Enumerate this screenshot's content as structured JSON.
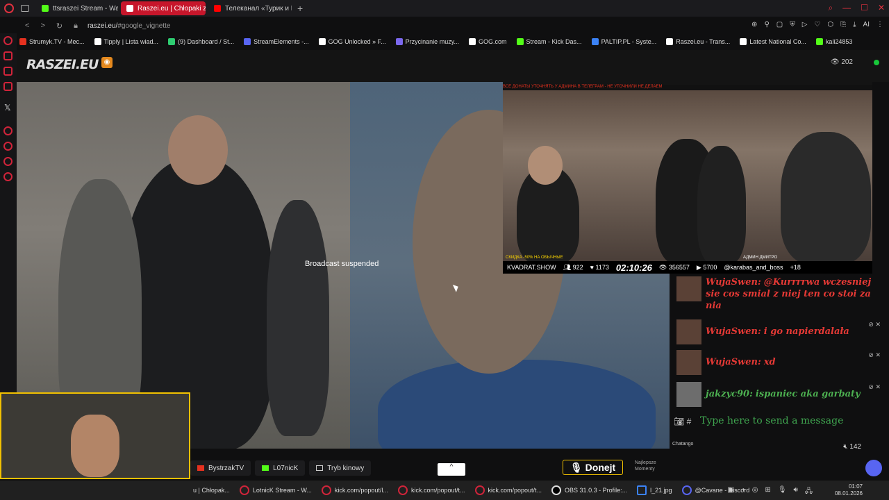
{
  "browser": {
    "tabs": [
      {
        "label": "ttsraszei Stream - Watch l",
        "active": false,
        "fav_color": "#53fc18"
      },
      {
        "label": "Raszei.eu | Chłopaki z Ra",
        "active": true,
        "fav_color": "#ffffff"
      },
      {
        "label": "Телеканал «Турик и К",
        "active": false,
        "fav_color": "#ff0000"
      }
    ],
    "new_tab": "+",
    "url_host": "raszei.eu/",
    "url_rest": "#google_vignette"
  },
  "bookmarks": [
    {
      "label": "Strumyk.TV - Mec...",
      "color": "#e5311f"
    },
    {
      "label": "Tipply | Lista wiad...",
      "color": "#ffffff"
    },
    {
      "label": "(9) Dashboard / St...",
      "color": "#2ecc71"
    },
    {
      "label": "StreamElements -...",
      "color": "#5865f2"
    },
    {
      "label": "GOG Unlocked » F...",
      "color": "#ffffff"
    },
    {
      "label": "Przycinanie muzy...",
      "color": "#7b68ee"
    },
    {
      "label": "GOG.com",
      "color": "#ffffff"
    },
    {
      "label": "Stream - Kick Das...",
      "color": "#53fc18"
    },
    {
      "label": "PALTIP.PL - Syste...",
      "color": "#3b82f6"
    },
    {
      "label": "Raszei.eu - Trans...",
      "color": "#ffffff"
    },
    {
      "label": "Latest National Co...",
      "color": "#ffffff"
    },
    {
      "label": "kali24853",
      "color": "#53fc18"
    }
  ],
  "site": {
    "logo": "RASZEI.EU",
    "viewers": "202",
    "broadcast_status": "Broadcast suspended"
  },
  "overlay": {
    "banner": "ВСЕ ДОНАТЫ УТОЧНЯТЬ У АДМИНА В ТЕЛЕГРАМ - НЕ УТОЧНИЛИ НЕ ДЕЛАЕМ",
    "discount": "СКИДКА -50% НА ОБЫЧНЫЕ",
    "admin": "АДМИН ДМИТРО",
    "site": "KVADRAT.SHOW",
    "viewers": "922",
    "likes": "1173",
    "time": "02:10:26",
    "eye": "356557",
    "yt": "5700",
    "handle": "@karabas_and_boss",
    "age": "+18"
  },
  "chat": {
    "messages": [
      {
        "user": "WujaSwen:",
        "text": "@Kurrrrwa wczesniej sie cos smial z niej ten co stoi za nia",
        "color": "red"
      },
      {
        "user": "WujaSwen:",
        "text": "i go napierdalała",
        "color": "red"
      },
      {
        "user": "WujaSwen:",
        "text": "xd",
        "color": "red"
      },
      {
        "user": "jakzyc90:",
        "text": "ispaniec aka garbaty",
        "color": "green"
      }
    ],
    "input_placeholder": "Type here to send a message",
    "footer_label": "Chatango",
    "count": "142"
  },
  "bottombar": {
    "buttons": [
      "BystrzakTV",
      "L07nicK",
      "Tryb kinowy"
    ],
    "up_label": "^",
    "donejt": "Donejt",
    "najlepsze_1": "Najlepsze",
    "najlepsze_2": "Momenty"
  },
  "taskbar": {
    "items": [
      "u | Chłopak...",
      "LotnicK Stream - W...",
      "kick.com/popout/l...",
      "kick.com/popout/t...",
      "kick.com/popout/t...",
      "OBS 31.0.3 - Profile:...",
      "l_21.jpg",
      "@Cavane - Discord"
    ],
    "time": "01:07",
    "date": "08.01.2026"
  }
}
